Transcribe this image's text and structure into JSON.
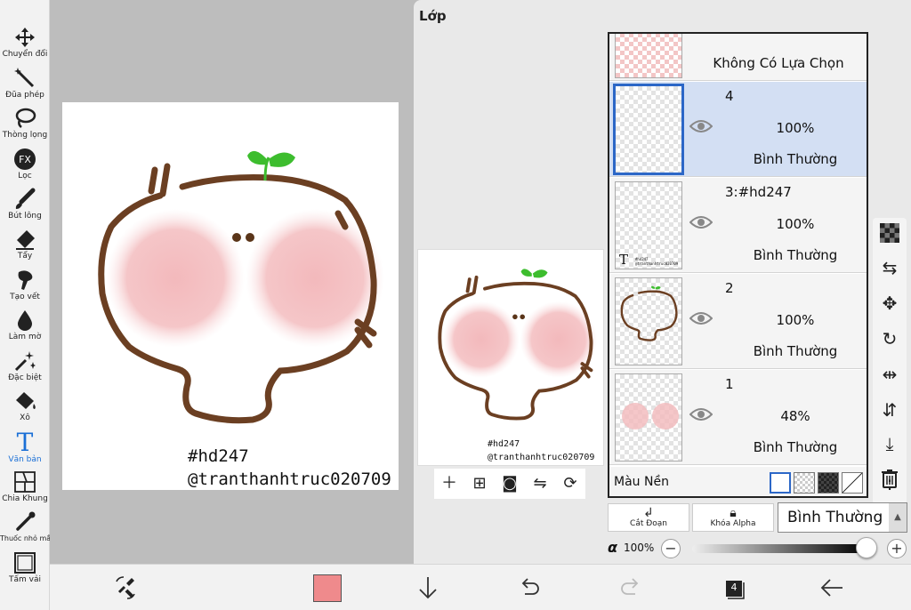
{
  "toolbar": {
    "tools": [
      {
        "label": "Chuyển đổi",
        "icon": "move-icon"
      },
      {
        "label": "Đũa phép",
        "icon": "magic-wand-icon"
      },
      {
        "label": "Thòng lọng",
        "icon": "lasso-icon"
      },
      {
        "label": "Lọc",
        "icon": "fx-filter-icon",
        "glyph": "FX"
      },
      {
        "label": "Bút lông",
        "icon": "brush-icon"
      },
      {
        "label": "Tẩy",
        "icon": "eraser-icon"
      },
      {
        "label": "Tạo vết",
        "icon": "smudge-icon"
      },
      {
        "label": "Làm mờ",
        "icon": "blur-drop-icon"
      },
      {
        "label": "Đặc biệt",
        "icon": "special-sparkle-icon"
      },
      {
        "label": "Xô",
        "icon": "bucket-icon"
      },
      {
        "label": "Văn bản",
        "icon": "text-icon",
        "glyph": "T",
        "active": true
      },
      {
        "label": "Chia Khung",
        "icon": "frame-divider-icon"
      },
      {
        "label": "Thuốc nhỏ mắt",
        "icon": "eyedropper-icon"
      },
      {
        "label": "Tấm vải",
        "icon": "canvas-icon"
      }
    ],
    "active_color": "#1a6fd6"
  },
  "canvas": {
    "signature_line1": "#hd247",
    "signature_line2": "@tranthanhtruc020709"
  },
  "layer_panel": {
    "title": "Lớp",
    "selection_row": {
      "label": "Không Có Lựa Chọn"
    },
    "layers": [
      {
        "name": "4",
        "opacity": "100%",
        "mode": "Bình Thường",
        "selected": true
      },
      {
        "name": "3:#hd247",
        "opacity": "100%",
        "mode": "Bình Thường",
        "selected": false,
        "thumb_text": "T"
      },
      {
        "name": "2",
        "opacity": "100%",
        "mode": "Bình Thường",
        "selected": false
      },
      {
        "name": "1",
        "opacity": "48%",
        "mode": "Bình Thường",
        "selected": false
      }
    ],
    "background_label": "Màu Nền",
    "preview_signature_line1": "#hd247",
    "preview_signature_line2": "@tranthanhtruc020709",
    "preview_tools": [
      "add-layer-icon",
      "add-layer-copy-icon",
      "camera-icon",
      "flip-horizontal-icon",
      "rotate-icon"
    ],
    "right_icons": [
      "checker-icon",
      "transfer-layer-icon",
      "move-layer-icon",
      "rotate-layer-icon",
      "flip-layer-icon",
      "flip-vertical-layer-icon",
      "merge-down-icon",
      "trash-icon",
      "more-icon"
    ]
  },
  "blend": {
    "clip_label": "Cắt Đoạn",
    "alpha_lock_label": "Khóa Alpha",
    "mode_value": "Bình Thường",
    "alpha_symbol": "α",
    "alpha_value": "100%",
    "alpha_fraction": 1.0
  },
  "bottom_bar": {
    "current_color": "#ef8a8c",
    "layer_count": "4"
  },
  "colors": {
    "selected_layer_bg": "#d3dff3",
    "selected_border": "#2c67c7",
    "cheek_pink": "#f3c2c4",
    "outline_brown": "#6b3f22",
    "sprout_green": "#3dbd2e"
  }
}
